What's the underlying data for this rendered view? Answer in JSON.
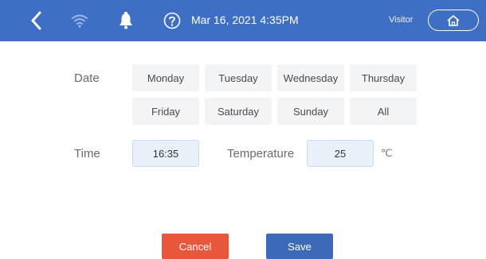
{
  "header": {
    "datetime": "Mar 16, 2021 4:35PM",
    "user": "Visitor",
    "icons": [
      "back-arrow-icon",
      "wifi-icon",
      "bell-icon",
      "help-icon",
      "home-icon"
    ]
  },
  "form": {
    "date_label": "Date",
    "days": [
      "Monday",
      "Tuesday",
      "Wednesday",
      "Thursday",
      "Friday",
      "Saturday",
      "Sunday",
      "All"
    ],
    "time_label": "Time",
    "time_value": "16:35",
    "temperature_label": "Temperature",
    "temperature_value": "25",
    "temperature_unit": "℃"
  },
  "actions": {
    "cancel": "Cancel",
    "save": "Save"
  },
  "colors": {
    "header": "#3e6fc4",
    "cancel": "#e8573a",
    "save": "#3d6ab8"
  }
}
